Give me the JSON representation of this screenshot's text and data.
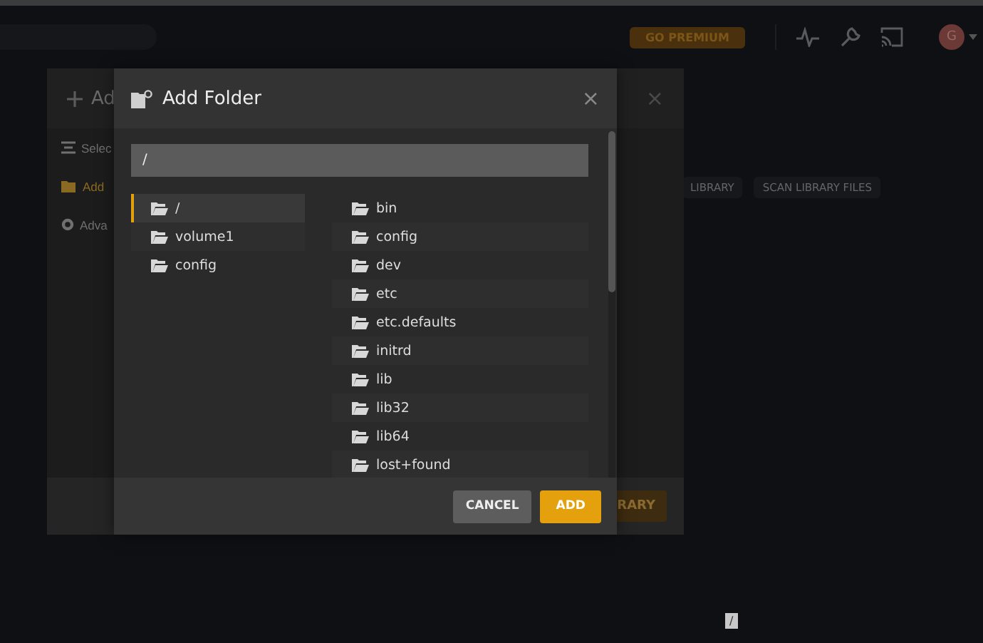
{
  "top_bar": {
    "premium_button": "GO PREMIUM",
    "avatar_initial": "G"
  },
  "library_buttons": [
    "LIBRARY",
    "SCAN LIBRARY FILES"
  ],
  "background_dialog": {
    "title": "Ad",
    "close": "×",
    "sidebar": [
      {
        "label": "Selec",
        "selected": false
      },
      {
        "label": "Add",
        "selected": true
      },
      {
        "label": "Adva",
        "selected": false
      }
    ],
    "footer_button": "RARY"
  },
  "dialog": {
    "title": "Add Folder",
    "close": "×",
    "path": "/",
    "roots": [
      {
        "label": "/",
        "selected": true
      },
      {
        "label": "volume1",
        "selected": false
      },
      {
        "label": "config",
        "selected": false
      }
    ],
    "folders": [
      "bin",
      "config",
      "dev",
      "etc",
      "etc.defaults",
      "initrd",
      "lib",
      "lib32",
      "lib64",
      "lost+found"
    ],
    "buttons": [
      {
        "label": "CANCEL",
        "kind": "secondary"
      },
      {
        "label": "ADD",
        "kind": "primary"
      }
    ]
  },
  "tooltip": "/"
}
